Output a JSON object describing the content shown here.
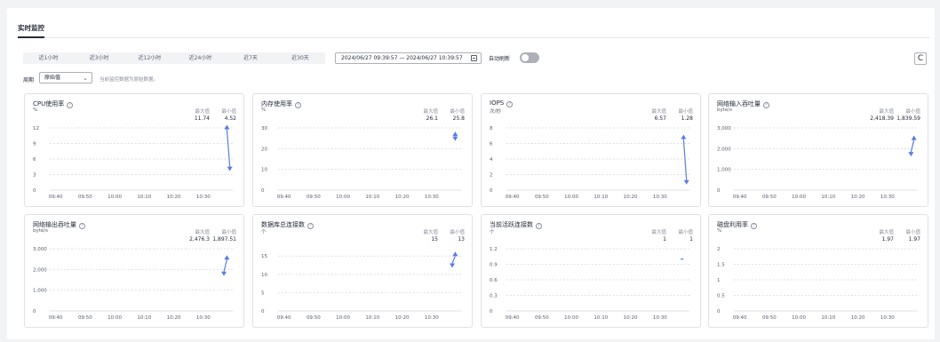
{
  "tab": "实时监控",
  "time_ranges": [
    "近1小时",
    "近3小时",
    "近12小时",
    "近24小时",
    "近7天",
    "近30天"
  ],
  "date_range": "2024/06/27 09:39:57 — 2024/06/27 10:39:57",
  "auto_refresh_label": "自动刷新",
  "auto_refresh_on": false,
  "refresh_icon": "C",
  "period_label": "周期",
  "period_value": "原始值",
  "period_hint": "当前监控数据为原始数据。",
  "stat_labels": {
    "max": "最大值",
    "min": "最小值"
  },
  "colors": {
    "series": "#5b7ce6",
    "grid": "#dfe1e6"
  },
  "chart_data": [
    {
      "type": "line",
      "title": "CPU使用率",
      "unit": "%",
      "max": "11.74",
      "min": "4.52",
      "x": [
        "09:40",
        "09:50",
        "10:00",
        "10:10",
        "10:20",
        "10:30"
      ],
      "yticks": [
        "12",
        "9",
        "6",
        "3",
        "0"
      ],
      "ylim": [
        0,
        12
      ],
      "xrange": [
        "09:38",
        "10:40"
      ],
      "points": [
        [
          "10:38",
          11.74
        ],
        [
          "10:39",
          4.52
        ]
      ]
    },
    {
      "type": "line",
      "title": "内存使用率",
      "unit": "%",
      "max": "26.1",
      "min": "25.8",
      "x": [
        "09:40",
        "09:50",
        "10:00",
        "10:10",
        "10:20",
        "10:30"
      ],
      "yticks": [
        "30",
        "20",
        "10",
        "0"
      ],
      "ylim": [
        0,
        30
      ],
      "xrange": [
        "09:38",
        "10:40"
      ],
      "points": [
        [
          "10:38",
          26.1
        ],
        [
          "10:38",
          25.8
        ]
      ]
    },
    {
      "type": "line",
      "title": "IOPS",
      "unit": "次/秒",
      "max": "6.57",
      "min": "1.28",
      "x": [
        "09:40",
        "09:50",
        "10:00",
        "10:10",
        "10:20",
        "10:30"
      ],
      "yticks": [
        "8",
        "6",
        "4",
        "2",
        "0"
      ],
      "ylim": [
        0,
        8
      ],
      "xrange": [
        "09:38",
        "10:40"
      ],
      "points": [
        [
          "10:38",
          6.57
        ],
        [
          "10:39",
          1.28
        ]
      ]
    },
    {
      "type": "line",
      "title": "网络输入吞吐量",
      "unit": "byte/s",
      "max": "2,418.39",
      "min": "1,839.59",
      "x": [
        "09:40",
        "09:50",
        "10:00",
        "10:10",
        "10:20",
        "10:30"
      ],
      "yticks": [
        "3,000",
        "2,000",
        "1,000",
        "0"
      ],
      "ylim": [
        0,
        3000
      ],
      "xrange": [
        "09:38",
        "10:40"
      ],
      "points": [
        [
          "10:39",
          2418.39
        ],
        [
          "10:38",
          1839.59
        ]
      ]
    },
    {
      "type": "line",
      "title": "网络输出吞吐量",
      "unit": "byte/s",
      "max": "2,476.3",
      "min": "1,897.51",
      "x": [
        "09:40",
        "09:50",
        "10:00",
        "10:10",
        "10:20",
        "10:30"
      ],
      "yticks": [
        "3,000",
        "2,000",
        "1,000",
        "0"
      ],
      "ylim": [
        0,
        3000
      ],
      "xrange": [
        "09:38",
        "10:40"
      ],
      "points": [
        [
          "10:38",
          2476.3
        ],
        [
          "10:37",
          1897.51
        ]
      ]
    },
    {
      "type": "line",
      "title": "数据库总连接数",
      "unit": "个",
      "max": "15",
      "min": "13",
      "x": [
        "09:40",
        "09:50",
        "10:00",
        "10:10",
        "10:20",
        "10:30"
      ],
      "yticks": [
        "15",
        "10",
        "5",
        "0"
      ],
      "ylim": [
        0,
        17
      ],
      "xrange": [
        "09:38",
        "10:40"
      ],
      "points": [
        [
          "10:38",
          15
        ],
        [
          "10:37",
          13
        ]
      ]
    },
    {
      "type": "line",
      "title": "当前活跃连接数",
      "unit": "个",
      "max": "1",
      "min": "1",
      "x": [
        "09:40",
        "09:50",
        "10:00",
        "10:10",
        "10:20",
        "10:30"
      ],
      "yticks": [
        "1.2",
        "0.9",
        "0.6",
        "0.3",
        "0"
      ],
      "ylim": [
        0,
        1.2
      ],
      "xrange": [
        "09:38",
        "10:40"
      ],
      "points": [
        [
          "10:37",
          1
        ],
        [
          "10:38",
          1
        ]
      ]
    },
    {
      "type": "line",
      "title": "磁盘利用率",
      "unit": "%",
      "max": "1.97",
      "min": "1.97",
      "x": [
        "09:40",
        "09:50",
        "10:00",
        "10:10",
        "10:20",
        "10:30"
      ],
      "yticks": [
        "2",
        "1.5",
        "1",
        "0.5",
        "0"
      ],
      "ylim": [
        0,
        2
      ],
      "xrange": [
        "09:38",
        "10:40"
      ],
      "points": [
        [
          "10:38",
          1.97
        ],
        [
          "10:38",
          1.97
        ]
      ]
    }
  ]
}
